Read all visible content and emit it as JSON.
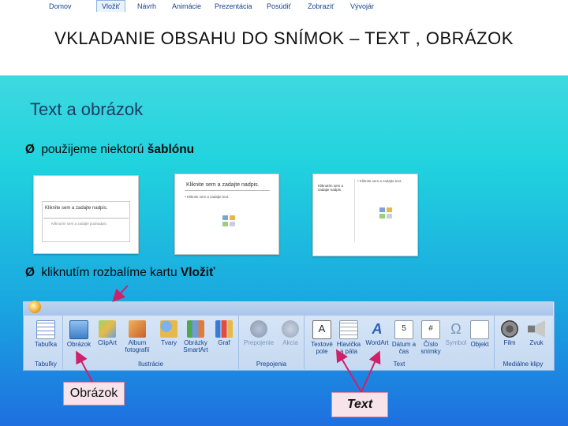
{
  "slide": {
    "title": "VKLADANIE OBSAHU DO SNÍMOK – TEXT , OBRÁZOK",
    "subtitle": "Text a obrázok",
    "bullet1": {
      "arrow": "Ø",
      "text": "použijeme niektorú ",
      "bold": "šablónu"
    },
    "bullet2": {
      "arrow": "Ø",
      "text": "kliknutím rozbalíme kartu ",
      "bold": "Vložiť"
    }
  },
  "thumbnails": [
    {
      "line1": "Kliknite sem a zadajte nadpis.",
      "line2": "Kliknutím sem a zadajte podnadpis."
    },
    {
      "line1": "Kliknite sem a zadajte nadpis.",
      "line2": "• Kliknite sem a zadajte text."
    },
    {
      "line1": "Kliknutím sem a zadajte nadpis",
      "line2": "• Kliknite sem a zadajte text."
    }
  ],
  "ribbon": {
    "tabs": [
      "Domov",
      "Vložiť",
      "Návrh",
      "Animácie",
      "Prezentácia",
      "Posúdiť",
      "Zobraziť",
      "Vývojár"
    ],
    "groups": [
      "Tabuľky",
      "Ilustrácie",
      "Prepojenia",
      "Text",
      "Mediálne klipy"
    ],
    "buttons": {
      "table": "Tabuľka",
      "picture": "Obrázok",
      "clipart": "ClipArt",
      "album": "Album fotografií",
      "shapes": "Tvary",
      "smartart": "Obrázky SmartArt",
      "chart": "Graf",
      "link": "Prepojenie",
      "action": "Akcia",
      "textbox": "Textové pole",
      "header": "Hlavička a päta",
      "wordart": "WordArt",
      "datetime": "Dátum a čas",
      "slidenum": "Číslo snímky",
      "symbol": "Symbol",
      "object": "Objekt",
      "movie": "Film",
      "sound": "Zvuk"
    }
  },
  "callouts": {
    "picture": "Obrázok",
    "text": "Text"
  },
  "colors": {
    "callout_border": "#d88aa5",
    "callout_fill": "#f7e3ea",
    "ribbon_text": "#15428b",
    "arrow": "#d0206a"
  }
}
